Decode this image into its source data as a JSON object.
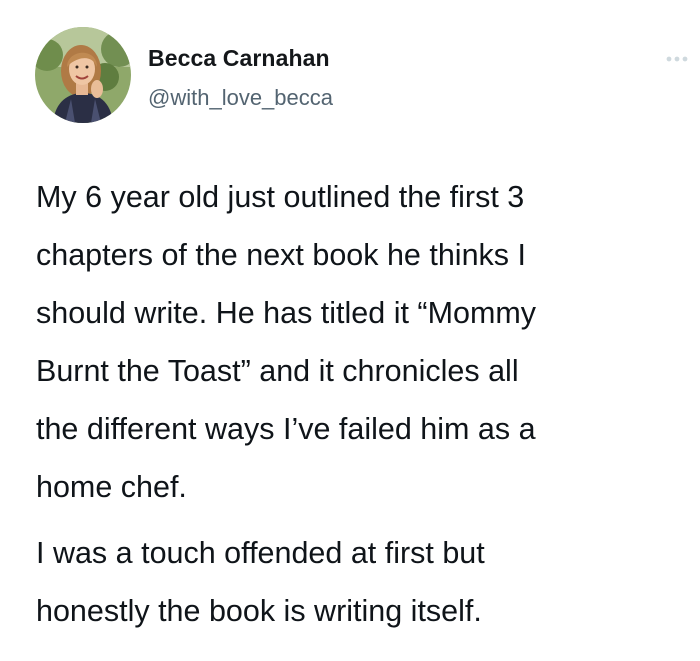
{
  "author": {
    "display_name": "Becca Carnahan",
    "handle": "@with_love_becca",
    "avatar_icon": "profile-photo"
  },
  "more_icon": "more-horizontal-icon",
  "tweet": {
    "paragraphs": [
      "My 6 year old just outlined the first 3\nchapters of the next book he thinks I\nshould write. He has titled it “Mommy\nBurnt the Toast” and it chronicles all\nthe different ways I’ve failed him as a\nhome chef.",
      "I was a touch offended at first but\nhonestly the book is writing itself."
    ]
  },
  "colors": {
    "text": "#0f1419",
    "secondary_text": "#536471",
    "background": "#ffffff",
    "more_icon": "#cfd9de"
  }
}
